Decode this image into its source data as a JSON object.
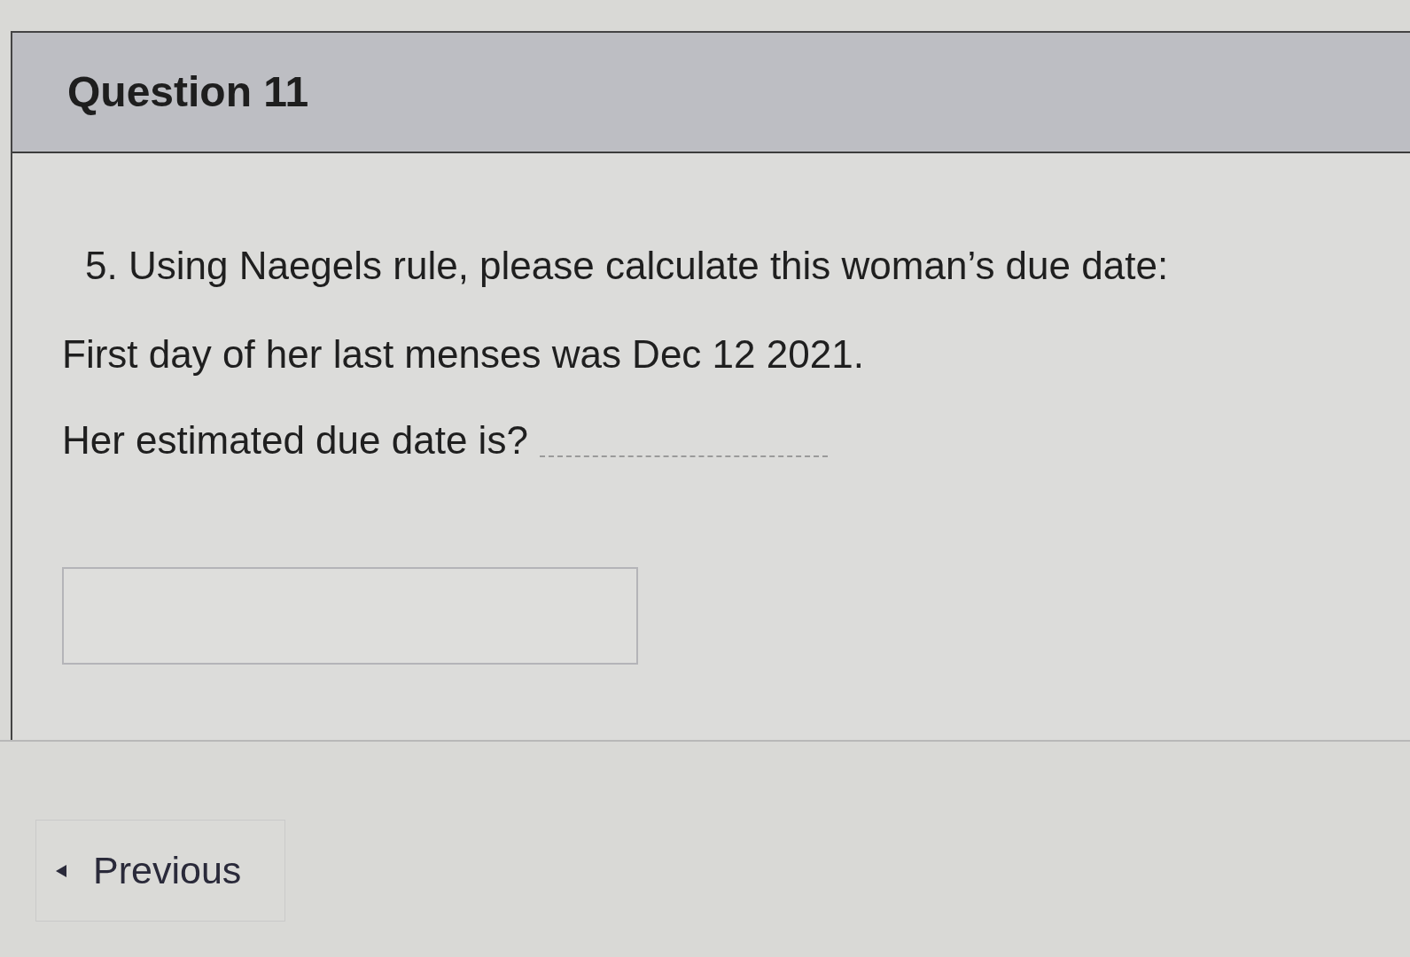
{
  "question": {
    "title": "Question 11"
  },
  "prompt": "5. Using Naegels rule, please calculate this woman’s due date:",
  "details": [
    "First day of her last menses was Dec 12 2021."
  ],
  "fill_in": {
    "label": "Her estimated due date is?"
  },
  "navigation": {
    "previous": "Previous"
  }
}
